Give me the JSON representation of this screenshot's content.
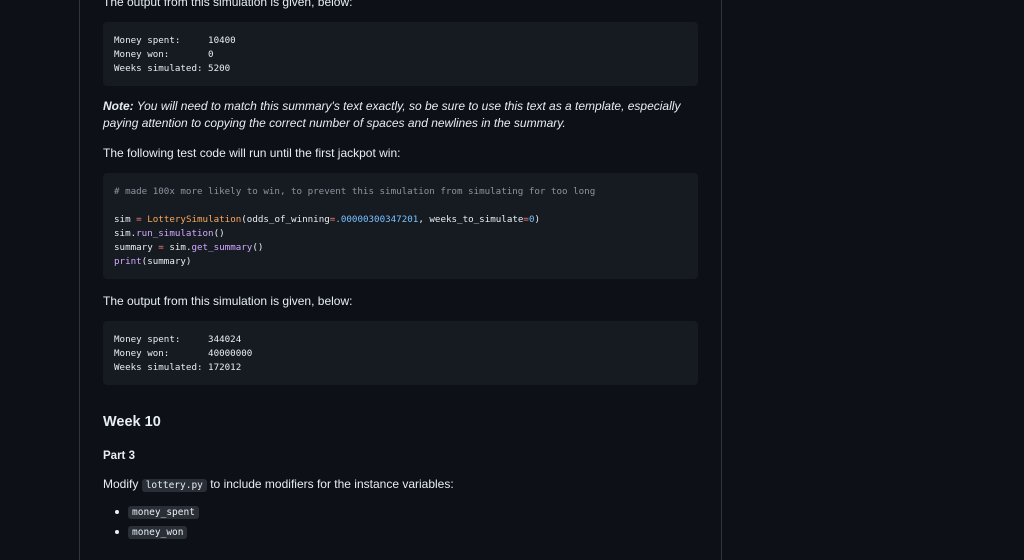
{
  "intro_top": "The output from this simulation is given, below:",
  "output1": {
    "lines": [
      {
        "label": "Money spent:     ",
        "value": "10400"
      },
      {
        "label": "Money won:       ",
        "value": "0"
      },
      {
        "label": "Weeks simulated: ",
        "value": "5200"
      }
    ]
  },
  "note": {
    "bold": "Note:",
    "text": " You will need to match this summary's text exactly, so be sure to use this text as a template, especially paying attention to copying the correct number of spaces and newlines in the summary."
  },
  "test_intro": "The following test code will run until the first jackpot win:",
  "code": {
    "comment": "# made 100x more likely to win, to prevent this simulation from simulating for too long",
    "l1_var": "sim",
    "l1_eq": " = ",
    "l1_cls": "LotterySimulation",
    "l1_arg1": "(odds_of_winning",
    "l1_op1": "=",
    "l1_num1": ".00000300347201",
    "l1_arg2": ", weeks_to_simulate",
    "l1_op2": "=",
    "l1_num2": "0",
    "l1_close": ")",
    "l2_obj": "sim.",
    "l2_fn": "run_simulation",
    "l2_rest": "()",
    "l3_var": "summary ",
    "l3_eq": "=",
    "l3_obj": " sim.",
    "l3_fn": "get_summary",
    "l3_rest": "()",
    "l4_fn": "print",
    "l4_rest": "(summary)"
  },
  "intro_output2": "The output from this simulation is given, below:",
  "output2": {
    "lines": [
      {
        "label": "Money spent:     ",
        "value": "344024"
      },
      {
        "label": "Money won:       ",
        "value": "40000000"
      },
      {
        "label": "Weeks simulated: ",
        "value": "172012"
      }
    ]
  },
  "week_heading": "Week 10",
  "part_heading": "Part 3",
  "modify": {
    "before": "Modify ",
    "code": "lottery.py",
    "after": " to include modifiers for the instance variables:"
  },
  "bullets": [
    "money_spent",
    "money_won"
  ]
}
